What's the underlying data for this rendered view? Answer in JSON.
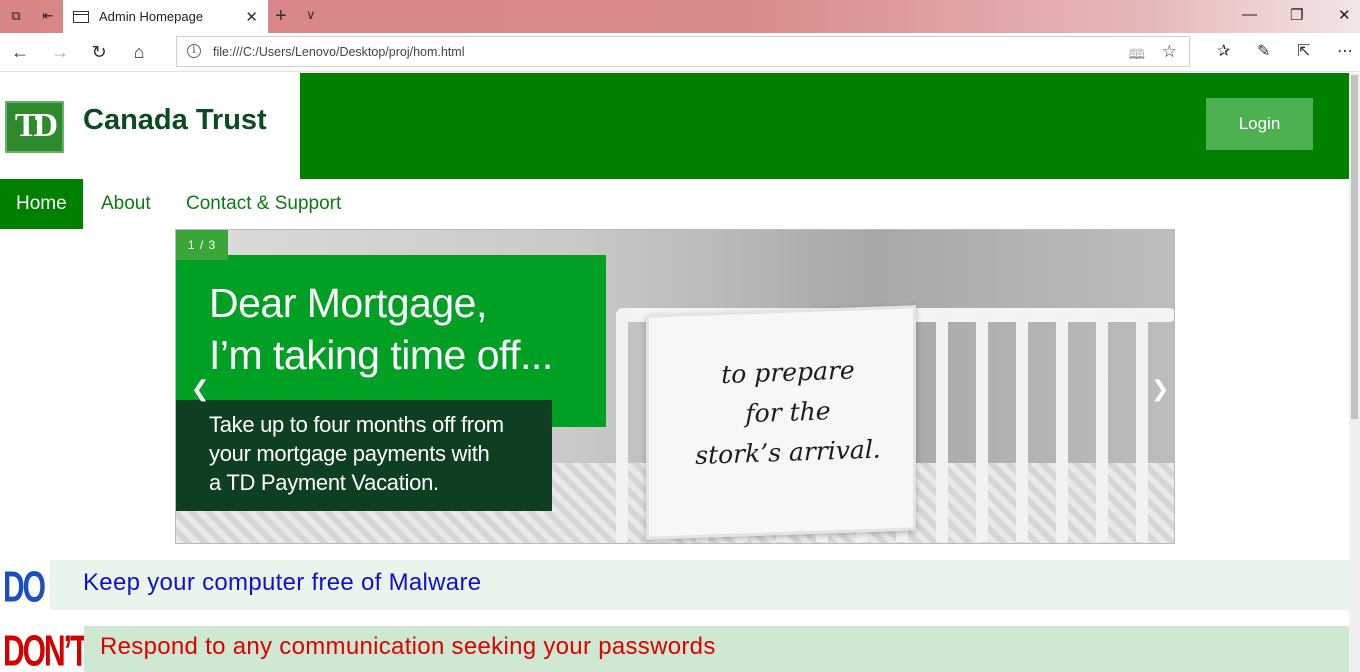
{
  "browser": {
    "tab_title": "Admin Homepage",
    "url": "file:///C:/Users/Lenovo/Desktop/proj/hom.html"
  },
  "header": {
    "logo_text": "TD",
    "brand": "Canada Trust",
    "login_label": "Login"
  },
  "menu": {
    "items": [
      {
        "label": "Home"
      },
      {
        "label": "About"
      },
      {
        "label": "Contact & Support"
      }
    ]
  },
  "carousel": {
    "counter": "1 / 3",
    "headline_line1": "Dear Mortgage,",
    "headline_line2": "I’m taking time off...",
    "body_line1": "Take up to four months off from",
    "body_line2": "your mortgage payments with",
    "body_line3": "a TD Payment Vacation.",
    "blanket_line1": "to prepare",
    "blanket_line2": "for the",
    "blanket_line3": "stork’s arrival.",
    "prev_symbol": "❮",
    "next_symbol": "❯"
  },
  "tips": {
    "do_badge": "DO",
    "do_text": "Keep your computer free of Malware",
    "dont_badge": "DON’T",
    "dont_text": "Respond to any communication seeking your passwords"
  },
  "colors": {
    "brand_green": "#008000",
    "login_green": "#4caf50",
    "do_blue": "#1010d0",
    "dont_red": "#e00000"
  }
}
